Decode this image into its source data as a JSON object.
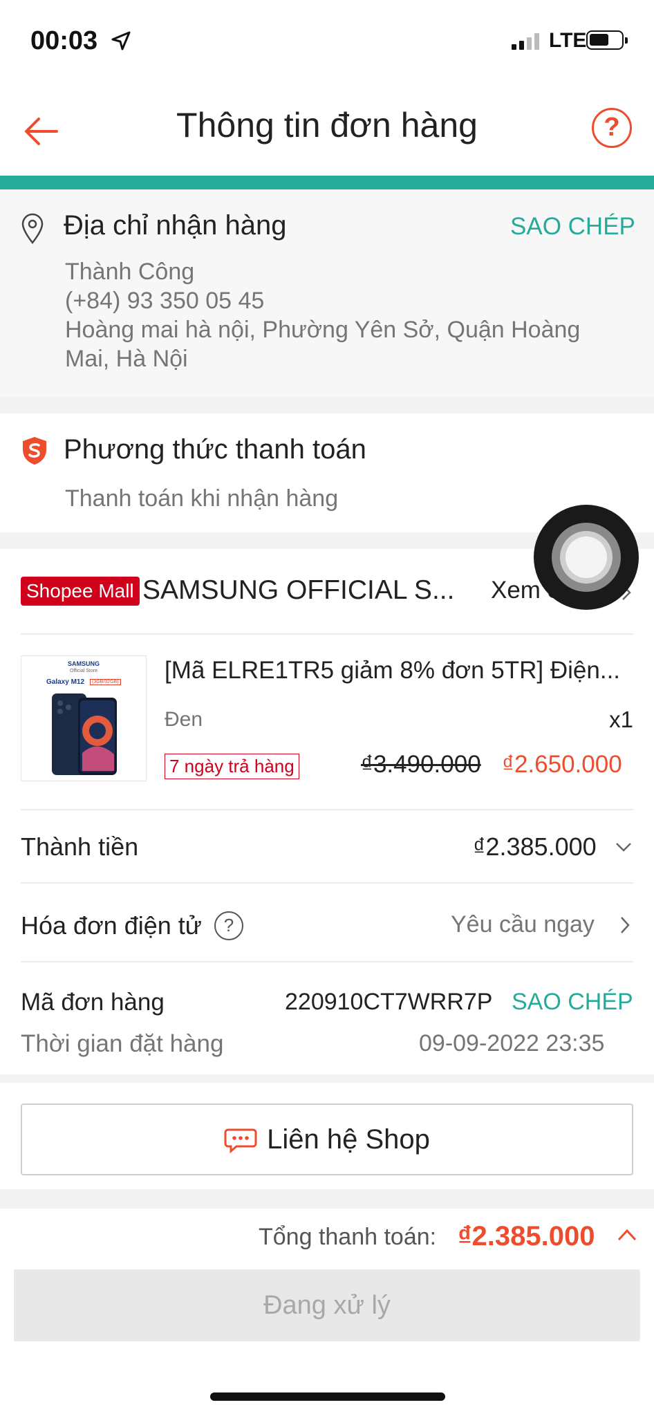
{
  "status_bar": {
    "time": "00:03",
    "network": "LTE"
  },
  "header": {
    "title": "Thông tin đơn hàng",
    "help": "?"
  },
  "address": {
    "title": "Địa chỉ nhận hàng",
    "copy_label": "SAO CHÉP",
    "name": "Thành Công",
    "phone": "(+84) 93 350 05 45",
    "line1": "Hoàng mai hà nội, Phường Yên Sở, Quận Hoàng",
    "line2": "Mai, Hà Nội"
  },
  "payment": {
    "title": "Phương thức thanh toán",
    "method": "Thanh toán khi nhận hàng"
  },
  "shop": {
    "badge": "Shopee Mall",
    "name": "SAMSUNG OFFICIAL S...",
    "view_label": "Xem Shop"
  },
  "product": {
    "image_brand": "SAMSUNG",
    "image_store": "Official Store",
    "image_model": "Galaxy M12",
    "image_model_tag": "(3GB/32GB)",
    "name": "[Mã ELRE1TR5 giảm 8% đơn 5TR] Điện...",
    "variant": "Đen",
    "quantity": "x1",
    "return_badge": "7 ngày trả hàng",
    "price_original": "₫3.490.000",
    "price_sale": "₫2.650.000"
  },
  "summary": {
    "subtotal_label": "Thành tiền",
    "subtotal_value": "₫2.385.000",
    "invoice_label": "Hóa đơn điện tử",
    "invoice_action": "Yêu cầu ngay",
    "order_id_label": "Mã đơn hàng",
    "order_id_value": "220910CT7WRR7P",
    "order_id_copy": "SAO CHÉP",
    "order_time_label": "Thời gian đặt hàng",
    "order_time_value": "09-09-2022 23:35"
  },
  "contact": {
    "label": "Liên hệ Shop"
  },
  "footer": {
    "total_label": "Tổng thanh toán:",
    "total_value": "₫2.385.000",
    "processing_label": "Đang xử lý"
  },
  "colors": {
    "accent": "#ee4d2d",
    "teal": "#26aa99",
    "mall_red": "#d0011b"
  }
}
